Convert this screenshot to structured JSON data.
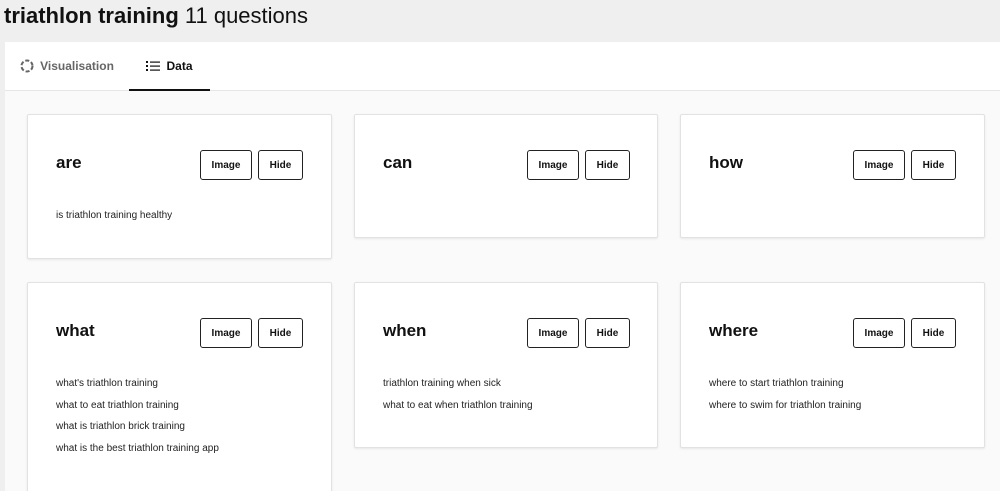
{
  "header": {
    "keyword": "triathlon training",
    "count_label": "11 questions"
  },
  "tabs": [
    {
      "label": "Visualisation",
      "icon": "circle-dash-icon",
      "active": false
    },
    {
      "label": "Data",
      "icon": "list-icon",
      "active": true
    }
  ],
  "colors": {
    "active_underline": "#111111",
    "inactive_tab_text": "#666666",
    "card_border": "#e2e2e2"
  },
  "cards": [
    {
      "word": "are",
      "image_label": "Image",
      "hide_label": "Hide",
      "questions": [
        "is triathlon training healthy"
      ]
    },
    {
      "word": "can",
      "image_label": "Image",
      "hide_label": "Hide",
      "questions": []
    },
    {
      "word": "how",
      "image_label": "Image",
      "hide_label": "Hide",
      "questions": []
    },
    {
      "word": "what",
      "image_label": "Image",
      "hide_label": "Hide",
      "questions": [
        "what's triathlon training",
        "what to eat triathlon training",
        "what is triathlon brick training",
        "what is the best triathlon training app"
      ]
    },
    {
      "word": "when",
      "image_label": "Image",
      "hide_label": "Hide",
      "questions": [
        "triathlon training when sick",
        "what to eat when triathlon training"
      ]
    },
    {
      "word": "where",
      "image_label": "Image",
      "hide_label": "Hide",
      "questions": [
        "where to start triathlon training",
        "where to swim for triathlon training"
      ]
    }
  ]
}
